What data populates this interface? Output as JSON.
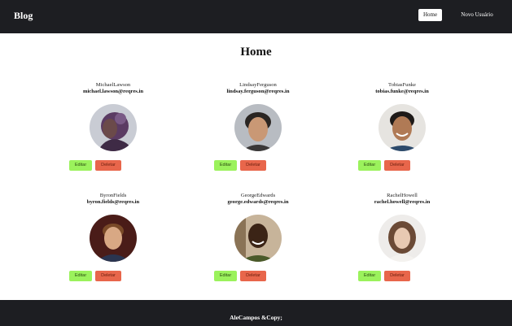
{
  "header": {
    "brand": "Blog",
    "nav": {
      "home": "Home",
      "new_user": "Novo Usuário"
    }
  },
  "page": {
    "title": "Home"
  },
  "users": [
    {
      "name": "MichaelLawson",
      "email": "michael.lawson@reqres.in",
      "edit_label": "Editar",
      "delete_label": "Deletar"
    },
    {
      "name": "LindsayFerguson",
      "email": "lindsay.ferguson@reqres.in",
      "edit_label": "Editar",
      "delete_label": "Deletar"
    },
    {
      "name": "TobiasFunke",
      "email": "tobias.funke@reqres.in",
      "edit_label": "Editar",
      "delete_label": "Deletar"
    },
    {
      "name": "ByronFields",
      "email": "byron.fields@reqres.in",
      "edit_label": "Editar",
      "delete_label": "Deletar"
    },
    {
      "name": "GeorgeEdwards",
      "email": "george.edwards@reqres.in",
      "edit_label": "Editar",
      "delete_label": "Deletar"
    },
    {
      "name": "RachelHowell",
      "email": "rachel.howell@reqres.in",
      "edit_label": "Editar",
      "delete_label": "Deletar"
    }
  ],
  "footer": {
    "text": "AleCampos &Copy;"
  },
  "colors": {
    "header_bg": "#1d1e22",
    "edit_button": "#9bf25c",
    "delete_button": "#e8664b"
  }
}
